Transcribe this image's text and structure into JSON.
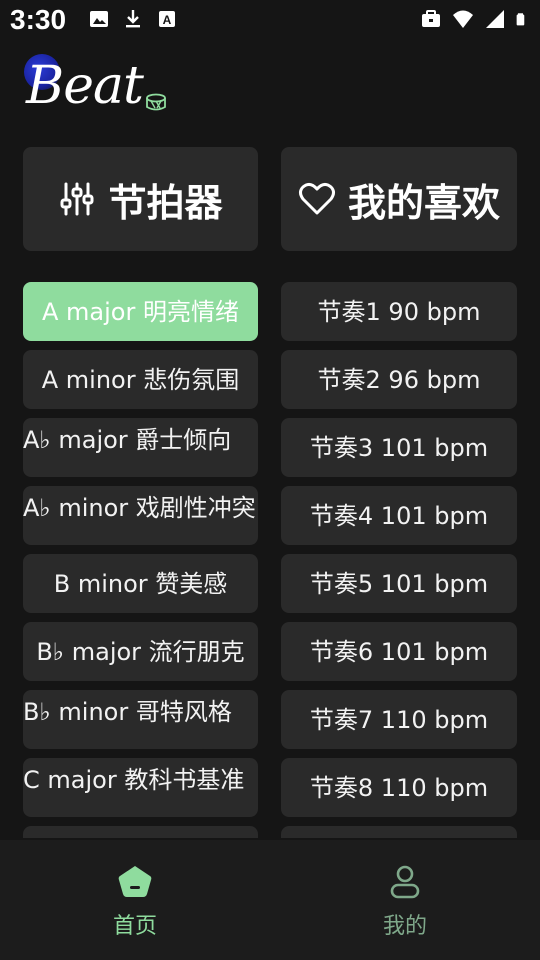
{
  "status_bar": {
    "time": "3:30",
    "left_icons": [
      "image-icon",
      "download-icon",
      "keyboard-a-icon"
    ],
    "right_icons": [
      "briefcase-icon",
      "wifi-icon",
      "signal-icon",
      "battery-icon"
    ]
  },
  "logo": {
    "text": "Beat",
    "icon": "drum-icon"
  },
  "top_cards": {
    "metronome": {
      "label": "节拍器",
      "icon": "sliders-icon"
    },
    "favorites": {
      "label": "我的喜欢",
      "icon": "heart-icon"
    }
  },
  "left_list": [
    {
      "label": "A major 明亮情绪",
      "active": true
    },
    {
      "label": "A minor 悲伤氛围",
      "active": false
    },
    {
      "label": "A♭ major 爵士倾向",
      "active": false
    },
    {
      "label": "A♭ minor 戏剧性冲突",
      "active": false
    },
    {
      "label": "B minor 赞美感",
      "active": false
    },
    {
      "label": "B♭ major 流行朋克",
      "active": false
    },
    {
      "label": "B♭ minor 哥特风格",
      "active": false
    },
    {
      "label": "C major 教科书基准",
      "active": false
    },
    {
      "label": "",
      "active": false
    }
  ],
  "right_list": [
    {
      "label": "节奏1 90 bpm"
    },
    {
      "label": "节奏2 96 bpm"
    },
    {
      "label": "节奏3 101 bpm"
    },
    {
      "label": "节奏4 101 bpm"
    },
    {
      "label": "节奏5 101 bpm"
    },
    {
      "label": "节奏6 101 bpm"
    },
    {
      "label": "节奏7 110 bpm"
    },
    {
      "label": "节奏8 110 bpm"
    },
    {
      "label": ""
    }
  ],
  "bottom_nav": {
    "home": {
      "label": "首页",
      "icon": "home-pentagon-icon",
      "active": true
    },
    "mine": {
      "label": "我的",
      "icon": "person-icon",
      "active": false
    }
  },
  "colors": {
    "background": "#151515",
    "card": "#2a2a2a",
    "accent": "#8fdc9e",
    "nav_inactive": "#7fa88a"
  }
}
